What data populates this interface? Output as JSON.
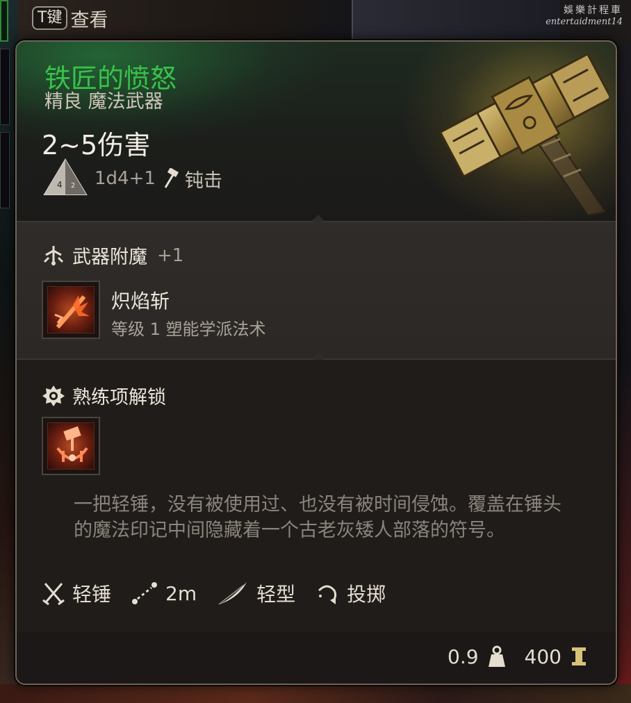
{
  "hud": {
    "key_label": "T键",
    "key_action": "查看"
  },
  "watermark": {
    "line1": "娛樂計程車",
    "line2": "entertaidment14"
  },
  "item": {
    "name": "铁匠的愤怒",
    "rarity_type": "精良 魔法武器",
    "damage": "2~5伤害",
    "dice": "1d4+1",
    "damage_type": "钝击"
  },
  "enchant_section": {
    "title": "武器附魔",
    "bonus": "+1",
    "spell_name": "炽焰斩",
    "spell_detail": "等级 1 塑能学派法术"
  },
  "proficiency_section": {
    "title": "熟练项解锁"
  },
  "description": "一把轻锤，没有被使用过、也没有被时间侵蚀。覆盖在锤头的魔法印记中间隐藏着一个古老灰矮人部落的符号。",
  "properties": [
    {
      "label": "轻锤",
      "icon": "crossed-weapons-icon"
    },
    {
      "label": "2m",
      "icon": "range-icon"
    },
    {
      "label": "轻型",
      "icon": "feather-icon"
    },
    {
      "label": "投掷",
      "icon": "throw-icon"
    }
  ],
  "footer": {
    "weight": "0.9",
    "price": "400"
  },
  "colors": {
    "item_name_green": "#38c24a",
    "text_primary": "#ece6da",
    "text_muted": "#a9a299",
    "panel_dark": "#201c1a",
    "panel_mid": "#2f2c2a",
    "border": "#6e6456"
  }
}
